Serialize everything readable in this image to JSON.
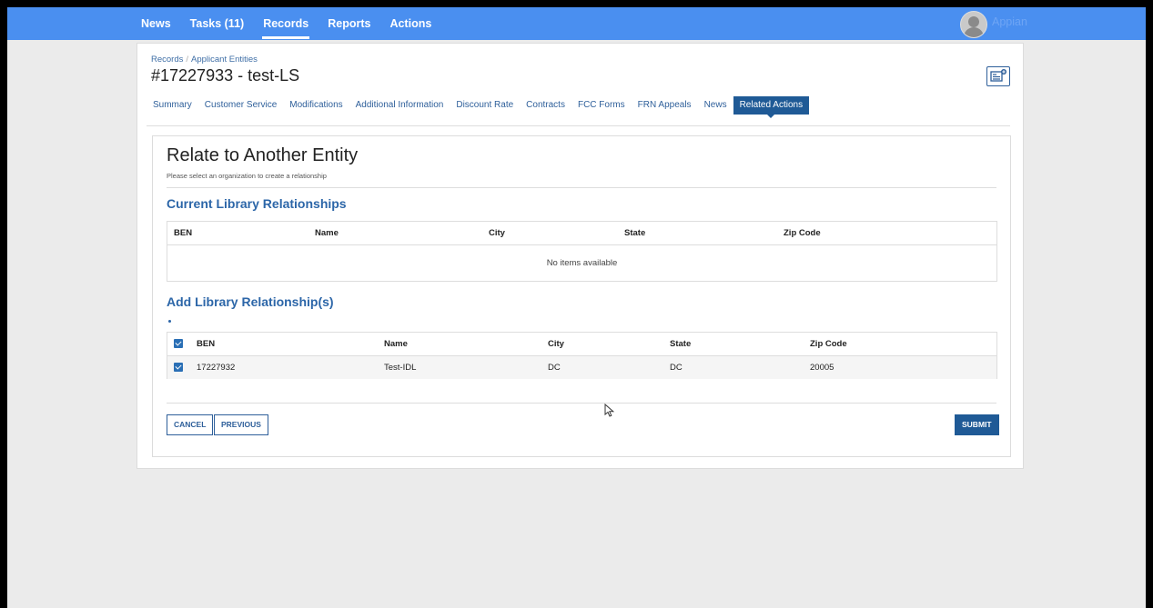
{
  "nav": {
    "items": [
      "News",
      "Tasks (11)",
      "Records",
      "Reports",
      "Actions"
    ],
    "active": "Records"
  },
  "user": {
    "brand": "Appian"
  },
  "breadcrumb": {
    "root": "Records",
    "sep": "/",
    "current": "Applicant Entities"
  },
  "record": {
    "title": "#17227933 - test-LS"
  },
  "tabs": [
    {
      "label": "Summary"
    },
    {
      "label": "Customer Service"
    },
    {
      "label": "Modifications"
    },
    {
      "label": "Additional Information"
    },
    {
      "label": "Discount Rate"
    },
    {
      "label": "Contracts"
    },
    {
      "label": "FCC Forms"
    },
    {
      "label": "FRN Appeals"
    },
    {
      "label": "News"
    },
    {
      "label": "Related Actions"
    }
  ],
  "form": {
    "title": "Relate to Another Entity",
    "subtitle": "Please select an organization to create a relationship",
    "current": {
      "title": "Current Library Relationships",
      "headers": [
        "BEN",
        "Name",
        "City",
        "State",
        "Zip Code"
      ],
      "empty": "No items available"
    },
    "add": {
      "title": "Add Library Relationship(s)",
      "headers": [
        "BEN",
        "Name",
        "City",
        "State",
        "Zip Code"
      ],
      "rows": [
        {
          "ben": "17227932",
          "name": "Test-IDL",
          "city": "DC",
          "state": "DC",
          "zip": "20005"
        }
      ]
    },
    "buttons": {
      "cancel": "CANCEL",
      "previous": "PREVIOUS",
      "submit": "SUBMIT"
    }
  },
  "colors": {
    "topbar": "#4a8ff0",
    "accent": "#1f5a96",
    "heading": "#2c66a8"
  }
}
